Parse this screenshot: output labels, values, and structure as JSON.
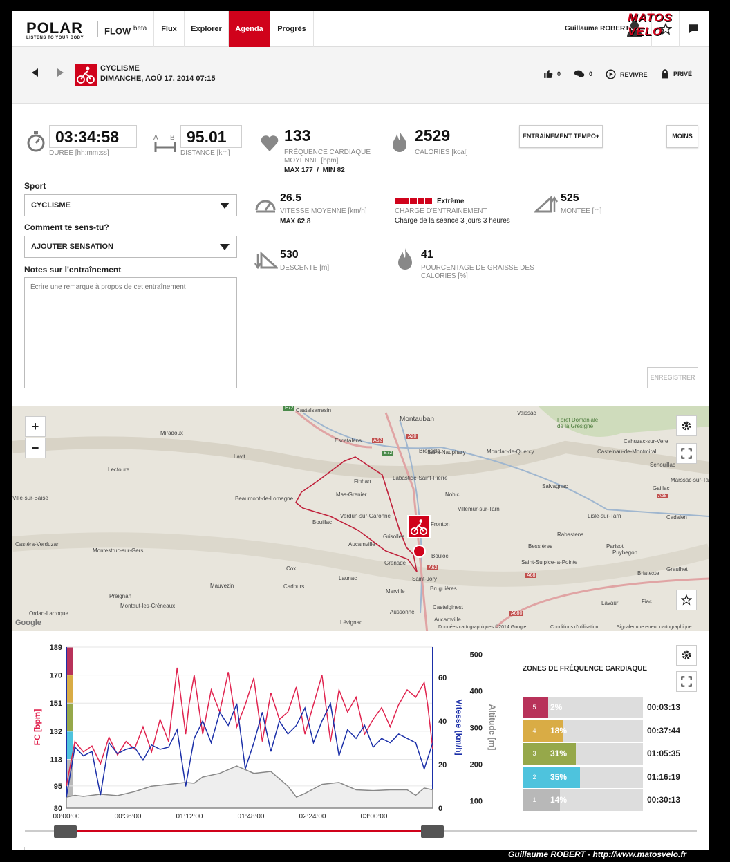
{
  "nav": {
    "brand": "POLAR",
    "tagline": "LISTENS TO YOUR BODY",
    "product": "FLOW",
    "product_suffix": "beta",
    "items": [
      {
        "label": "Flux"
      },
      {
        "label": "Explorer"
      },
      {
        "label": "Agenda",
        "active": true
      },
      {
        "label": "Progrès"
      }
    ],
    "user": "Guillaume ROBERT"
  },
  "watermark": "MATOS VELO",
  "header": {
    "sport": "CYCLISME",
    "datetime": "DIMANCHE, AOÛ 17, 2014 07:15",
    "likes": "0",
    "comments": "0",
    "relive": "REVIVRE",
    "privacy": "PRIVÉ"
  },
  "stats": {
    "duration": {
      "value": "03:34:58",
      "label": "DURÉE [hh:mm:ss]"
    },
    "distance": {
      "value": "95.01",
      "label": "DISTANCE [km]"
    },
    "heart_rate": {
      "value": "133",
      "label": "FRÉQUENCE CARDIAQUE MOYENNE [bpm]",
      "sub": "MAX 177  /  MIN 82"
    },
    "calories": {
      "value": "2529",
      "label": "CALORIES [kcal]"
    },
    "speed": {
      "value": "26.5",
      "label": "VITESSE MOYENNE [km/h]",
      "sub": "MAX 62.8"
    },
    "load": {
      "level": "Extrême",
      "label": "CHARGE D'ENTRAÎNEMENT",
      "sub": "Charge de la séance 3 jours 3 heures"
    },
    "ascent": {
      "value": "525",
      "label": "MONTÉE [m]"
    },
    "descent": {
      "value": "530",
      "label": "DESCENTE [m]"
    },
    "fat": {
      "value": "41",
      "label": "POURCENTAGE DE GRAISSE DES CALORIES [%]"
    }
  },
  "buttons": {
    "tempo": "ENTRAÎNEMENT TEMPO+",
    "less": "MOINS",
    "save": "ENREGISTRER"
  },
  "form": {
    "sport_label": "Sport",
    "sport_value": "CYCLISME",
    "feel_label": "Comment te sens-tu?",
    "feel_value": "AJOUTER SENSATION",
    "notes_label": "Notes sur l'entraînement",
    "notes_placeholder": "Écrire une remarque à propos de cet entraînement"
  },
  "map": {
    "attribution": "Données cartographiques ©2014 Google",
    "terms": "Conditions d'utilisation",
    "report": "Signaler une erreur cartographique",
    "google": "Google",
    "places": [
      "Castelsarrasin",
      "Montauban",
      "Vaissac",
      "Forêt Domaniale de la Grésigne",
      "Miradoux",
      "Escatalens",
      "Bressols",
      "Saint-Nauphary",
      "Monclar-de-Quercy",
      "Cahuzac-sur-Vere",
      "Lavit",
      "Castelnau-de-Montmiral",
      "Lectoure",
      "Finhan",
      "Labastide-Saint-Pierre",
      "Senouillac",
      "Marssac-sur-Tarn",
      "Mas-Grenier",
      "Nohic",
      "Salvagnac",
      "Gaillac",
      "Beaumont-de-Lomagne",
      "Villemur-sur-Tarn",
      "Verdun-sur-Garonne",
      "Bouillac",
      "Lisle-sur-Tarn",
      "Cadalen",
      "Grisolles",
      "Fronton",
      "Rabastens",
      "Aucamville",
      "Bessières",
      "Parisot",
      "Castéra-Verduzan",
      "Montestruc-sur-Gers",
      "Bouloc",
      "Puybegon",
      "Saint-Sulpice-la-Pointe",
      "Grenade",
      "Cox",
      "Saint-Jory",
      "Graulhet",
      "Launac",
      "Briatexte",
      "Mauvezin",
      "Cadours",
      "Bruguières",
      "Merville",
      "Lavaur",
      "Fiac",
      "Preignan",
      "Castelginest",
      "Montaut-les-Créneaux",
      "Ordan-Larroque",
      "Aussonne",
      "Aucamville",
      "Lévignac",
      "Ville-sur-Baïse"
    ],
    "roads": [
      "E72",
      "A62",
      "A20",
      "E72",
      "A68",
      "A62",
      "A68",
      "A680"
    ]
  },
  "chart_data": {
    "type": "line",
    "xlabel": "",
    "x_ticks": [
      "00:00:00",
      "00:36:00",
      "01:12:00",
      "01:48:00",
      "02:24:00",
      "03:00:00"
    ],
    "y_left": {
      "label": "FC [bpm]",
      "ticks": [
        80,
        95,
        113,
        132,
        151,
        170,
        189
      ],
      "range": [
        80,
        189
      ]
    },
    "y_right1": {
      "label": "Vitesse [km/h]",
      "ticks": [
        0,
        20,
        40,
        60
      ],
      "range": [
        0,
        74
      ]
    },
    "y_right2": {
      "label": "Altitude [m]",
      "ticks": [
        100,
        200,
        300,
        400,
        500
      ],
      "range": [
        80,
        520
      ]
    },
    "duration_minutes": 215,
    "series": [
      {
        "name": "FC [bpm]",
        "color": "#e0244f",
        "x_minutes": [
          0,
          5,
          10,
          15,
          20,
          25,
          30,
          35,
          40,
          45,
          50,
          55,
          60,
          65,
          70,
          72,
          75,
          80,
          85,
          90,
          95,
          100,
          105,
          110,
          115,
          120,
          125,
          130,
          135,
          140,
          145,
          150,
          155,
          160,
          165,
          170,
          175,
          180,
          185,
          190,
          195,
          200,
          205,
          210,
          212,
          215
        ],
        "values": [
          95,
          125,
          118,
          122,
          110,
          128,
          116,
          125,
          120,
          135,
          118,
          140,
          125,
          175,
          130,
          150,
          170,
          130,
          160,
          145,
          172,
          135,
          150,
          168,
          125,
          158,
          140,
          145,
          162,
          130,
          150,
          170,
          125,
          160,
          145,
          155,
          130,
          140,
          148,
          135,
          150,
          160,
          155,
          165,
          150,
          120
        ]
      },
      {
        "name": "Vitesse [km/h]",
        "color": "#1b2fa8",
        "x_minutes": [
          0,
          5,
          10,
          15,
          20,
          25,
          30,
          35,
          40,
          45,
          50,
          55,
          60,
          65,
          70,
          75,
          80,
          85,
          90,
          95,
          100,
          105,
          110,
          115,
          120,
          125,
          130,
          135,
          140,
          145,
          150,
          155,
          160,
          165,
          170,
          175,
          180,
          185,
          190,
          195,
          200,
          205,
          210,
          215
        ],
        "values": [
          5,
          28,
          24,
          26,
          6,
          30,
          25,
          27,
          28,
          22,
          29,
          27,
          28,
          36,
          10,
          32,
          40,
          30,
          44,
          38,
          48,
          18,
          30,
          44,
          26,
          40,
          34,
          38,
          46,
          30,
          40,
          48,
          24,
          36,
          32,
          38,
          28,
          32,
          30,
          34,
          32,
          30,
          18,
          30
        ]
      },
      {
        "name": "Altitude [m]",
        "color": "#888888",
        "x_minutes": [
          0,
          5,
          10,
          20,
          30,
          40,
          50,
          60,
          70,
          75,
          80,
          90,
          100,
          110,
          120,
          130,
          135,
          140,
          150,
          160,
          170,
          180,
          190,
          200,
          205,
          210,
          215
        ],
        "values": [
          110,
          115,
          112,
          118,
          114,
          125,
          140,
          145,
          150,
          148,
          165,
          175,
          195,
          175,
          180,
          140,
          110,
          120,
          145,
          150,
          130,
          128,
          130,
          130,
          115,
          135,
          130
        ]
      }
    ]
  },
  "zones": {
    "title": "ZONES DE FRÉQUENCE CARDIAQUE",
    "rows": [
      {
        "zone": "5",
        "pct": "2%",
        "pct_value": 2,
        "time": "00:03:13",
        "color": "#b8325a"
      },
      {
        "zone": "4",
        "pct": "18%",
        "pct_value": 18,
        "time": "00:37:44",
        "color": "#d9ac45"
      },
      {
        "zone": "3",
        "pct": "31%",
        "pct_value": 31,
        "time": "01:05:35",
        "color": "#96a84a"
      },
      {
        "zone": "2",
        "pct": "35%",
        "pct_value": 35,
        "time": "01:16:19",
        "color": "#4ec3dd"
      },
      {
        "zone": "1",
        "pct": "14%",
        "pct_value": 14,
        "time": "00:30:13",
        "color": "#b8b8b8"
      }
    ]
  },
  "caption": "Guillaume ROBERT - http://www.matosvelo.fr"
}
